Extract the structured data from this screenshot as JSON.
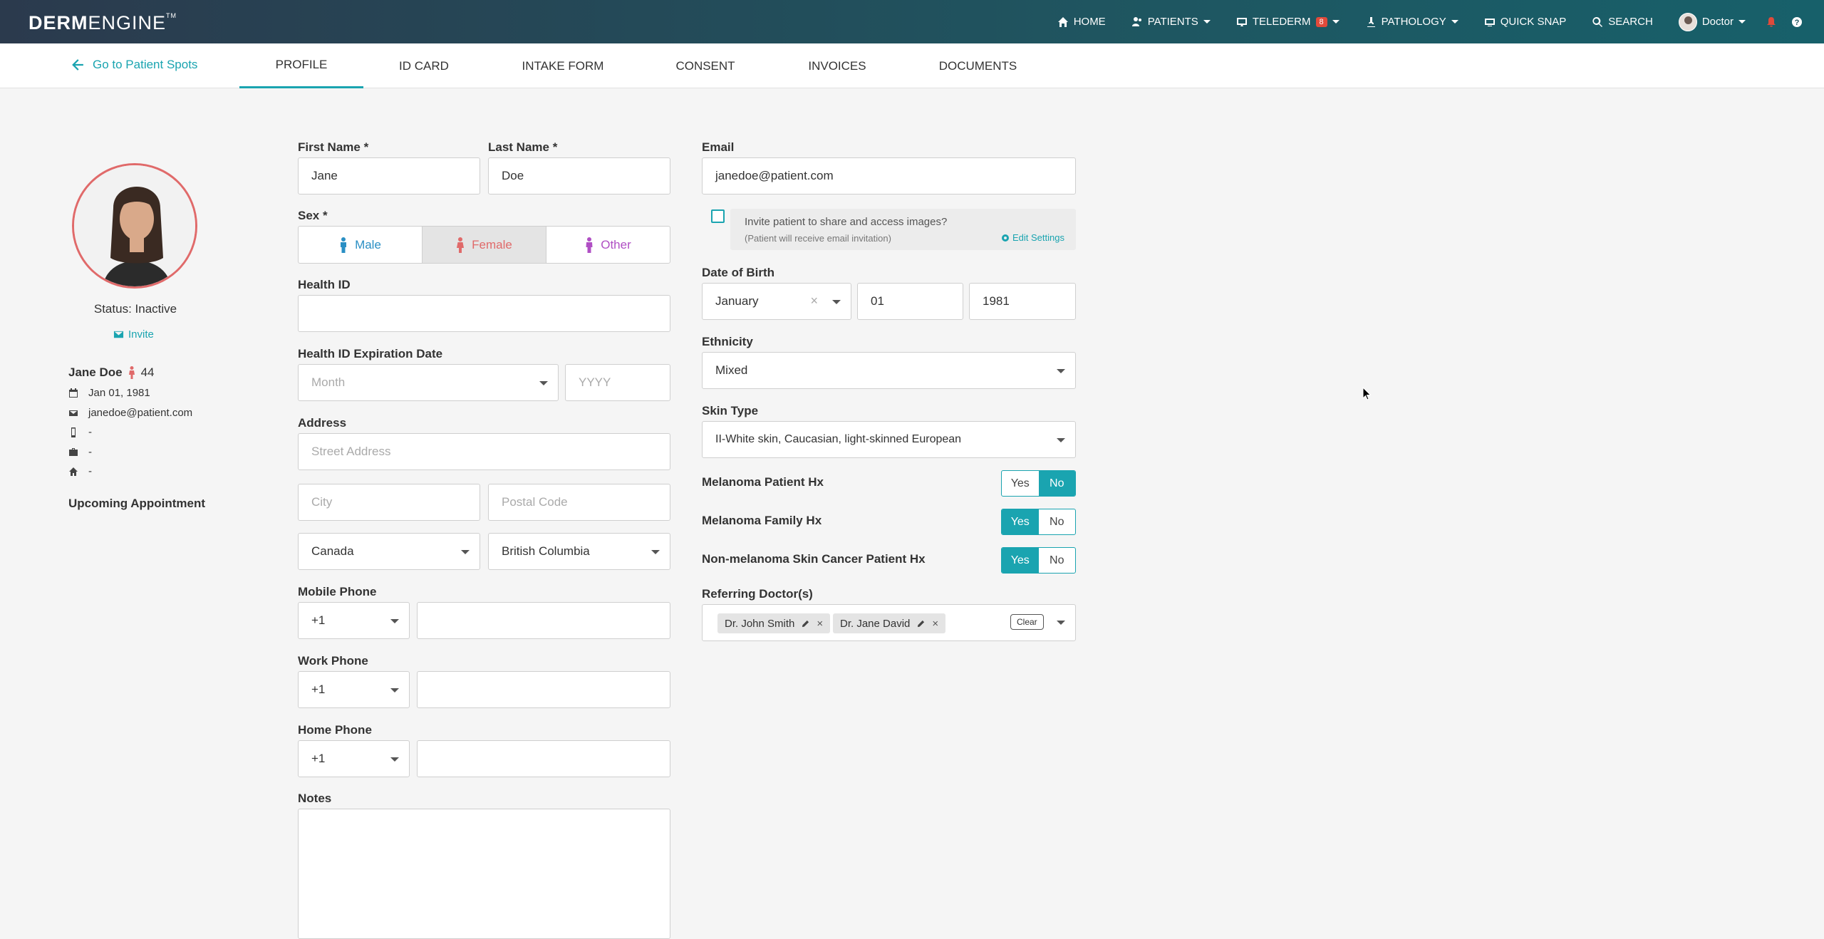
{
  "nav": {
    "logo_bold": "DERM",
    "logo_light": "ENGINE",
    "logo_tm": "TM",
    "home": "HOME",
    "patients": "PATIENTS",
    "telederm": "TELEDERM",
    "telederm_badge": "8",
    "pathology": "PATHOLOGY",
    "quick_snap": "QUICK SNAP",
    "search": "SEARCH",
    "user": "Doctor"
  },
  "tabs": {
    "back": "Go to Patient Spots",
    "items": [
      "PROFILE",
      "ID CARD",
      "INTAKE FORM",
      "CONSENT",
      "INVOICES",
      "DOCUMENTS"
    ]
  },
  "profile": {
    "status": "Status: Inactive",
    "invite": "Invite",
    "name": "Jane Doe",
    "age": "44",
    "dob": "Jan 01, 1981",
    "email": "janedoe@patient.com",
    "mobile": "-",
    "work": "-",
    "home": "-",
    "upcoming": "Upcoming Appointment"
  },
  "form": {
    "first_name_label": "First Name *",
    "first_name": "Jane",
    "last_name_label": "Last Name *",
    "last_name": "Doe",
    "sex_label": "Sex *",
    "sex_male": "Male",
    "sex_female": "Female",
    "sex_other": "Other",
    "health_id_label": "Health ID",
    "health_id": "",
    "hid_exp_label": "Health ID Expiration Date",
    "month_placeholder": "Month",
    "year_placeholder": "YYYY",
    "address_label": "Address",
    "street_placeholder": "Street Address",
    "city_placeholder": "City",
    "postal_placeholder": "Postal Code",
    "country": "Canada",
    "province": "British Columbia",
    "mobile_label": "Mobile Phone",
    "work_label": "Work Phone",
    "home_label": "Home Phone",
    "phone_code": "+1",
    "notes_label": "Notes",
    "email_label": "Email",
    "email": "janedoe@patient.com",
    "invite_text": "Invite patient to share and access images?",
    "invite_sub": "(Patient will receive email invitation)",
    "edit_settings": "Edit Settings",
    "dob_label": "Date of Birth",
    "dob_month": "January",
    "dob_day": "01",
    "dob_year": "1981",
    "ethnicity_label": "Ethnicity",
    "ethnicity": "Mixed",
    "skin_type_label": "Skin Type",
    "skin_type": "II-White skin, Caucasian, light-skinned European",
    "melanoma_patient_label": "Melanoma Patient Hx",
    "melanoma_family_label": "Melanoma Family Hx",
    "nonmelanoma_label": "Non-melanoma Skin Cancer Patient Hx",
    "yes": "Yes",
    "no": "No",
    "referring_label": "Referring Doctor(s)",
    "doctor1": "Dr. John Smith",
    "doctor2": "Dr. Jane David",
    "clear": "Clear"
  },
  "colors": {
    "accent": "#1aa4b0",
    "female": "#e06a6a",
    "male": "#2a8fc4",
    "other": "#b04fc4"
  }
}
